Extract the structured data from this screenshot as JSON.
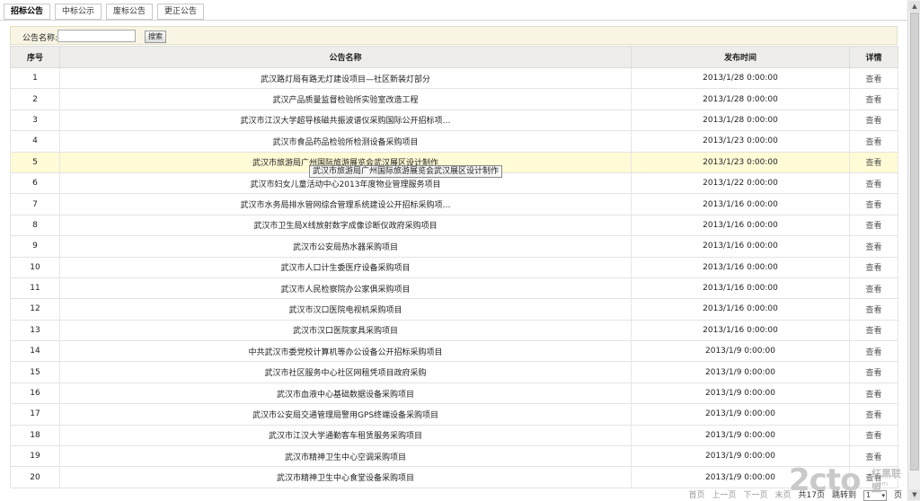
{
  "tabs": [
    "招标公告",
    "中标公示",
    "废标公告",
    "更正公告"
  ],
  "active_tab": 0,
  "search": {
    "label": "公告名称:",
    "value": "",
    "button": "搜索"
  },
  "table": {
    "headers": [
      "序号",
      "公告名称",
      "发布时间",
      "详情"
    ],
    "rows": [
      [
        "1",
        "武汉路灯局有路无灯建设项目—社区新装灯部分",
        "2013/1/28 0:00:00",
        "查看"
      ],
      [
        "2",
        "武汉产品质量监督检验所实验室改造工程",
        "2013/1/28 0:00:00",
        "查看"
      ],
      [
        "3",
        "武汉市江汉大学超导核磁共振波谱仪采购国际公开招标项…",
        "2013/1/28 0:00:00",
        "查看"
      ],
      [
        "4",
        "武汉市食品药品检验所检测设备采购项目",
        "2013/1/23 0:00:00",
        "查看"
      ],
      [
        "5",
        "武汉市旅游局广州国际旅游展览会武汉展区设计制作",
        "2013/1/23 0:00:00",
        "查看"
      ],
      [
        "6",
        "武汉市妇女儿童活动中心2013年度物业管理服务项目",
        "2013/1/22 0:00:00",
        "查看"
      ],
      [
        "7",
        "武汉市水务局排水管网综合管理系统建设公开招标采购项…",
        "2013/1/16 0:00:00",
        "查看"
      ],
      [
        "8",
        "武汉市卫生局X线放射数字成像诊断仪政府采购项目",
        "2013/1/16 0:00:00",
        "查看"
      ],
      [
        "9",
        "武汉市公安局热水器采购项目",
        "2013/1/16 0:00:00",
        "查看"
      ],
      [
        "10",
        "武汉市人口计生委医疗设备采购项目",
        "2013/1/16 0:00:00",
        "查看"
      ],
      [
        "11",
        "武汉市人民检察院办公家俱采购项目",
        "2013/1/16 0:00:00",
        "查看"
      ],
      [
        "12",
        "武汉市汉口医院电视机采购项目",
        "2013/1/16 0:00:00",
        "查看"
      ],
      [
        "13",
        "武汉市汉口医院家具采购项目",
        "2013/1/16 0:00:00",
        "查看"
      ],
      [
        "14",
        "中共武汉市委党校计算机等办公设备公开招标采购项目",
        "2013/1/9 0:00:00",
        "查看"
      ],
      [
        "15",
        "武汉市社区服务中心社区网租凭项目政府采购",
        "2013/1/9 0:00:00",
        "查看"
      ],
      [
        "16",
        "武汉市血液中心基础数据设备采购项目",
        "2013/1/9 0:00:00",
        "查看"
      ],
      [
        "17",
        "武汉市公安局交通管理局警用GPS终端设备采购项目",
        "2013/1/9 0:00:00",
        "查看"
      ],
      [
        "18",
        "武汉市江汉大学通勤客车租赁服务采购项目",
        "2013/1/9 0:00:00",
        "查看"
      ],
      [
        "19",
        "武汉市精神卫生中心空调采购项目",
        "2013/1/9 0:00:00",
        "查看"
      ],
      [
        "20",
        "武汉市精神卫生中心食堂设备采购项目",
        "2013/1/9 0:00:00",
        "查看"
      ]
    ]
  },
  "highlighted_row": 4,
  "tooltip": "武汉市旅游局广州国际旅游展览会武汉展区设计制作",
  "pager": {
    "first": "首页",
    "prev": "上一页",
    "next": "下一页",
    "last": "末页",
    "total": "共17页",
    "jump": "跳转到",
    "page_value": "1",
    "page_suffix": "页"
  },
  "watermark": {
    "big": "2cto",
    "small": "红黑联盟",
    "sub": ".com"
  },
  "colors": {
    "highlight_row": "#fffbd6",
    "search_bar": "#f8f5e4",
    "header_bg": "#eeede9"
  }
}
